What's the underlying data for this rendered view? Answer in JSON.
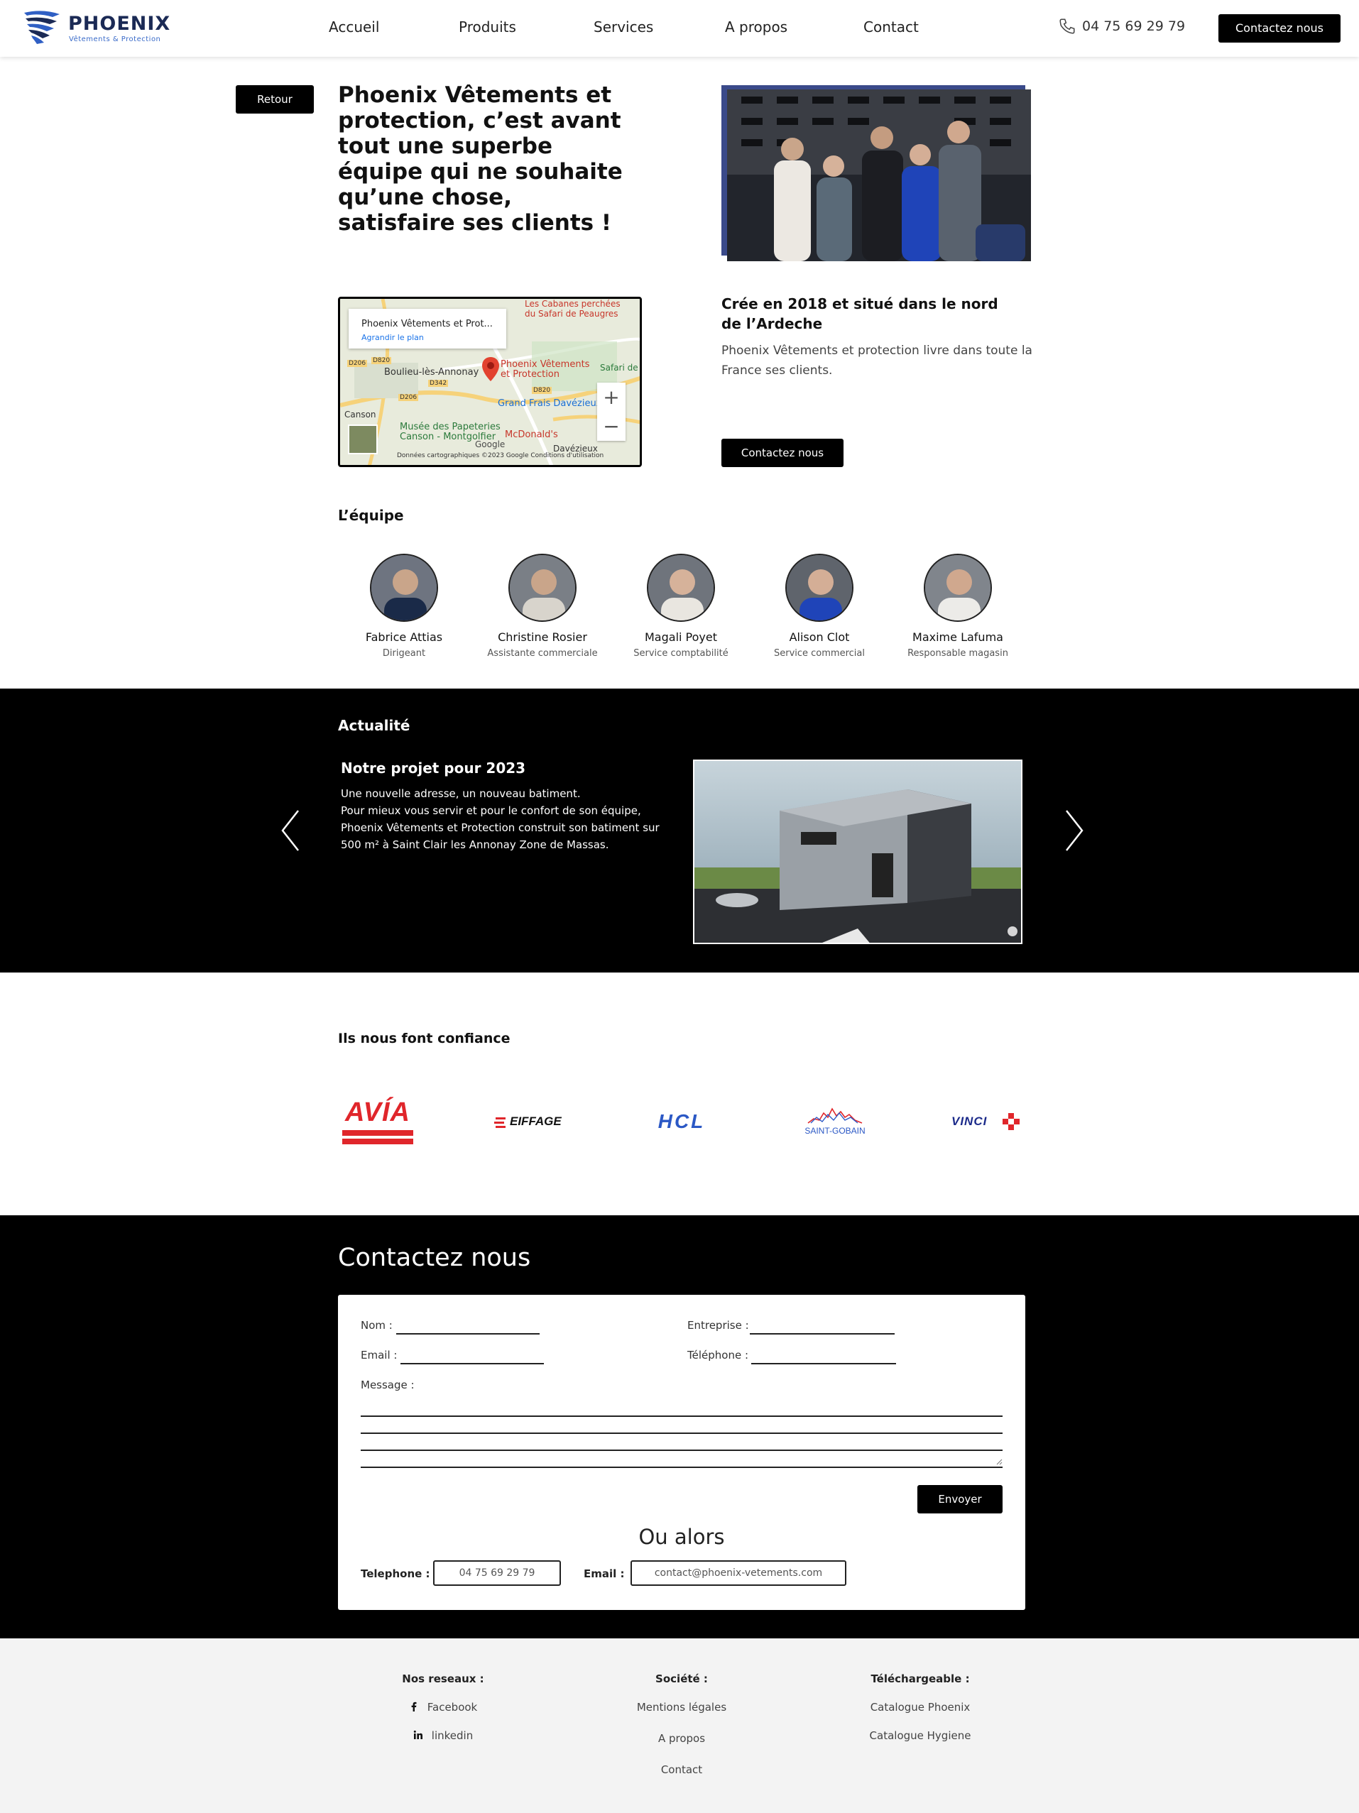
{
  "header": {
    "logo_text": "PHOENIX",
    "logo_sub": "Vêtements & Protection",
    "nav": [
      "Accueil",
      "Produits",
      "Services",
      "A propos",
      "Contact"
    ],
    "phone": "04 75 69 29 79",
    "cta": "Contactez nous"
  },
  "intro": {
    "back_label": "Retour",
    "headline": "Phoenix Vêtements et protection, c’est avant tout une superbe équipe qui ne souhaite qu’une chose, satisfaire ses clients !"
  },
  "map": {
    "card_title": "Phoenix Vêtements et Prot...",
    "card_link": "Agrandir le plan",
    "labels": [
      "Boulieu-lès-Annonay",
      "Phoenix Vêtements et Protection",
      "Grand Frais Davézieux",
      "Musée des Papeteries Canson - Montgolfier",
      "McDonald's",
      "Les Cabanes perchées du Safari de Peaugres",
      "Safari de",
      "Canson",
      "Davézieux"
    ],
    "roads": [
      "D206",
      "D820",
      "D342",
      "D206",
      "D820"
    ],
    "attribution": "Données cartographiques ©2023 Google   Conditions d'utilisation",
    "google": "Google"
  },
  "info": {
    "title": "Crée en 2018 et situé dans le nord de l’Ardeche",
    "text": "Phoenix Vêtements et protection livre dans toute la France ses clients.",
    "cta": "Contactez nous"
  },
  "team": {
    "heading": "L’équipe",
    "members": [
      {
        "name": "Fabrice Attias",
        "role": "Dirigeant"
      },
      {
        "name": "Christine Rosier",
        "role": "Assistante commerciale"
      },
      {
        "name": "Magali Poyet",
        "role": "Service comptabilité"
      },
      {
        "name": "Alison Clot",
        "role": "Service commercial"
      },
      {
        "name": "Maxime Lafuma",
        "role": "Responsable magasin"
      }
    ]
  },
  "news": {
    "heading": "Actualité",
    "title": "Notre projet pour 2023",
    "line1": "Une nouvelle adresse, un nouveau batiment.",
    "line2": "Pour mieux vous servir et pour le confort de son équipe, Phoenix Vêtements et Protection construit son batiment sur 500 m² à Saint Clair les Annonay Zone de Massas."
  },
  "clients": {
    "heading": "Ils nous font confiance",
    "logos": [
      "AVÍA",
      "EIFFAGE",
      "HCL",
      "SAINT-GOBAIN",
      "VINCI"
    ]
  },
  "contact": {
    "title": "Contactez nous",
    "fields": {
      "nom": "Nom :",
      "entreprise": "Entreprise :",
      "email": "Email :",
      "telephone": "Téléphone :",
      "message": "Message :"
    },
    "send": "Envoyer",
    "or": "Ou alors",
    "phone_label": "Telephone :",
    "phone_value": "04 75 69 29 79",
    "email_label": "Email :",
    "email_value": "contact@phoenix-vetements.com"
  },
  "footer": {
    "networks_title": "Nos reseaux :",
    "networks": [
      "Facebook",
      "linkedin"
    ],
    "company_title": "Société :",
    "company": [
      "Mentions légales",
      "A propos",
      "Contact"
    ],
    "downloads_title": "Téléchargeable :",
    "downloads": [
      "Catalogue Phoenix",
      "Catalogue Hygiene"
    ]
  },
  "colors": {
    "brand_blue": "#1b2a55",
    "accent_blue": "#3a6bc9",
    "black": "#000000",
    "footer_bg": "#f3f3f3"
  }
}
